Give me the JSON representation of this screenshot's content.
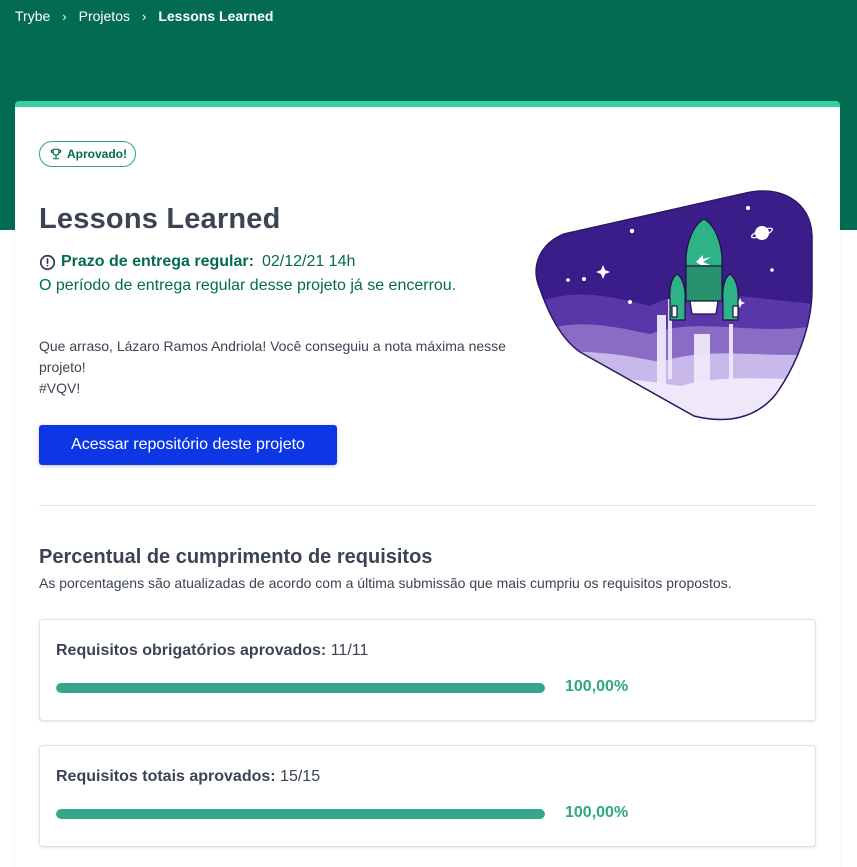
{
  "breadcrumb": {
    "items": [
      "Trybe",
      "Projetos"
    ],
    "current": "Lessons Learned",
    "separator": "›"
  },
  "badge": {
    "label": "Aprovado!",
    "icon": "trophy-icon"
  },
  "project": {
    "title": "Lessons Learned",
    "deadline_label": "Prazo de entrega regular:",
    "deadline_value": "02/12/21 14h",
    "closed_message": "O período de entrega regular desse projeto já se encerrou.",
    "congrats_line1": "Que arraso, Lázaro Ramos Andriola! Você conseguiu a nota máxima nesse",
    "congrats_line2": "projeto!",
    "congrats_line3": "#VQV!",
    "repo_button": "Acessar repositório deste projeto"
  },
  "requirements": {
    "title": "Percentual de cumprimento de requisitos",
    "subtitle": "As porcentagens são atualizadas de acordo com a última submissão que mais cumpriu os requisitos propostos.",
    "cards": [
      {
        "label": "Requisitos obrigatórios aprovados:",
        "value": "11/11",
        "percent_text": "100,00%",
        "progress": 1.0
      },
      {
        "label": "Requisitos totais aprovados:",
        "value": "15/15",
        "percent_text": "100,00%",
        "progress": 1.0
      }
    ]
  },
  "colors": {
    "header_green": "#036b52",
    "accent_green": "#35d1a1",
    "button_blue": "#0d36e5",
    "progress_green": "#35a68a"
  }
}
